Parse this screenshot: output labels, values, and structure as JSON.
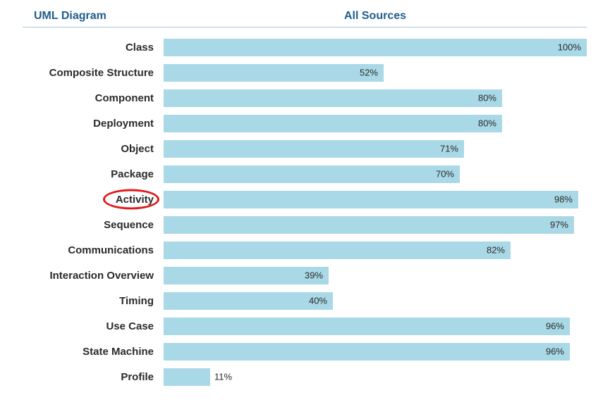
{
  "chart_data": {
    "type": "bar",
    "orientation": "horizontal",
    "title": "",
    "xlabel": "All Sources",
    "ylabel": "UML Diagram",
    "xlim": [
      0,
      100
    ],
    "categories": [
      "Class",
      "Composite Structure",
      "Component",
      "Deployment",
      "Object",
      "Package",
      "Activity",
      "Sequence",
      "Communications",
      "Interaction Overview",
      "Timing",
      "Use Case",
      "State Machine",
      "Profile"
    ],
    "values": [
      100,
      52,
      80,
      80,
      71,
      70,
      98,
      97,
      82,
      39,
      40,
      96,
      96,
      11
    ],
    "highlighted_category": "Activity",
    "colors": {
      "bar": "#a9d8e6",
      "header_text": "#1f5d8c",
      "highlight_ring": "#e21a1a"
    }
  },
  "headers": {
    "left": "UML Diagram",
    "right": "All Sources"
  },
  "rows": [
    {
      "label": "Class",
      "pct": "100%",
      "w": 100,
      "outside": false,
      "circled": false
    },
    {
      "label": "Composite Structure",
      "pct": "52%",
      "w": 52,
      "outside": false,
      "circled": false
    },
    {
      "label": "Component",
      "pct": "80%",
      "w": 80,
      "outside": false,
      "circled": false
    },
    {
      "label": "Deployment",
      "pct": "80%",
      "w": 80,
      "outside": false,
      "circled": false
    },
    {
      "label": "Object",
      "pct": "71%",
      "w": 71,
      "outside": false,
      "circled": false
    },
    {
      "label": "Package",
      "pct": "70%",
      "w": 70,
      "outside": false,
      "circled": false
    },
    {
      "label": "Activity",
      "pct": "98%",
      "w": 98,
      "outside": false,
      "circled": true
    },
    {
      "label": "Sequence",
      "pct": "97%",
      "w": 97,
      "outside": false,
      "circled": false
    },
    {
      "label": "Communications",
      "pct": "82%",
      "w": 82,
      "outside": false,
      "circled": false
    },
    {
      "label": "Interaction Overview",
      "pct": "39%",
      "w": 39,
      "outside": false,
      "circled": false
    },
    {
      "label": "Timing",
      "pct": "40%",
      "w": 40,
      "outside": false,
      "circled": false
    },
    {
      "label": "Use Case",
      "pct": "96%",
      "w": 96,
      "outside": false,
      "circled": false
    },
    {
      "label": "State Machine",
      "pct": "96%",
      "w": 96,
      "outside": false,
      "circled": false
    },
    {
      "label": "Profile",
      "pct": "11%",
      "w": 11,
      "outside": true,
      "circled": false
    }
  ]
}
